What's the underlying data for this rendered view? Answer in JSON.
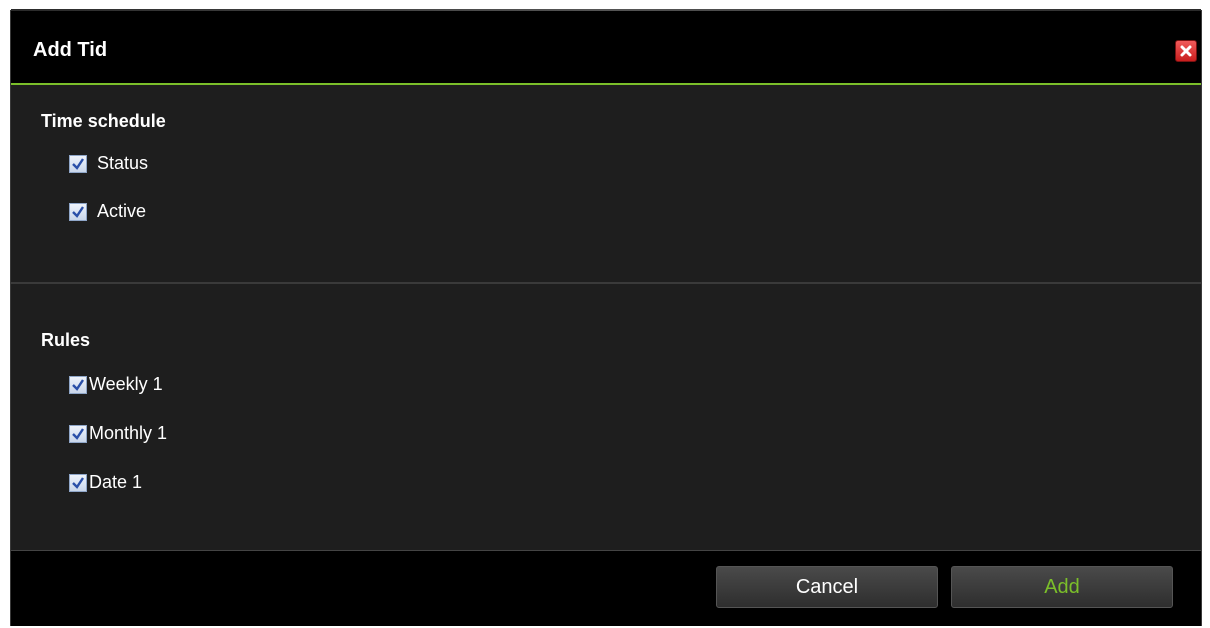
{
  "dialog": {
    "title": "Add Tid",
    "close_icon": "close-icon",
    "accent_color": "#7bbf2a"
  },
  "time_schedule": {
    "heading": "Time schedule",
    "items": [
      {
        "label": "Status",
        "checked": true
      },
      {
        "label": "Active",
        "checked": true
      }
    ]
  },
  "rules": {
    "heading": "Rules",
    "items": [
      {
        "label": "Weekly 1",
        "checked": true
      },
      {
        "label": "Monthly 1",
        "checked": true
      },
      {
        "label": "Date 1",
        "checked": true
      }
    ]
  },
  "footer": {
    "cancel_label": "Cancel",
    "add_label": "Add"
  }
}
